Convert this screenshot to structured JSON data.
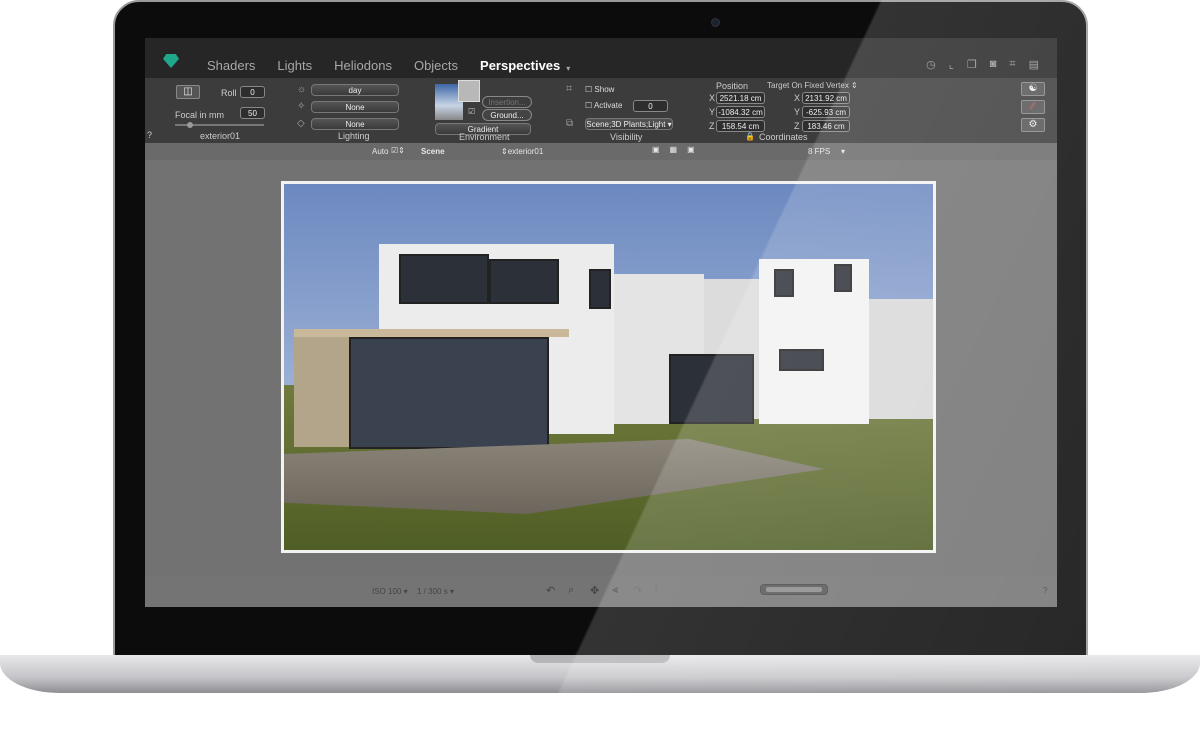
{
  "tabs": [
    "Shaders",
    "Lights",
    "Heliodons",
    "Objects",
    "Perspectives"
  ],
  "active_tab": "Perspectives",
  "camera": {
    "roll_label": "Roll",
    "roll": "0",
    "focal_label": "Focal in mm",
    "focal": "50",
    "name": "exterior01",
    "help": "?"
  },
  "lighting": {
    "sun": "day",
    "light1": "None",
    "light2": "None",
    "label": "Lighting"
  },
  "environment": {
    "insertion": "Insertion...",
    "ground": "Ground...",
    "mode": "Gradient",
    "label": "Environment"
  },
  "visibility": {
    "show": "Show",
    "activate": "Activate",
    "activate_value": "0",
    "layers": "Scene;3D Plants;Light",
    "label": "Visibility"
  },
  "coordinates": {
    "position_label": "Position",
    "target_label": "Target On Fixed Vertex",
    "px": "2521.18 cm",
    "py": "-1084.32 cm",
    "pz": "158.54 cm",
    "tx": "2131.92 cm",
    "ty": "-625.93 cm",
    "tz": "183.46 cm",
    "label": "Coordinates",
    "x": "X",
    "y": "Y",
    "z": "Z"
  },
  "subbar": {
    "auto": "Auto",
    "scene": "Scene",
    "view": "exterior01",
    "fps": "8 FPS"
  },
  "bottom": {
    "iso": "ISO 100",
    "shutter": "1 / 300 s",
    "help": "?"
  }
}
